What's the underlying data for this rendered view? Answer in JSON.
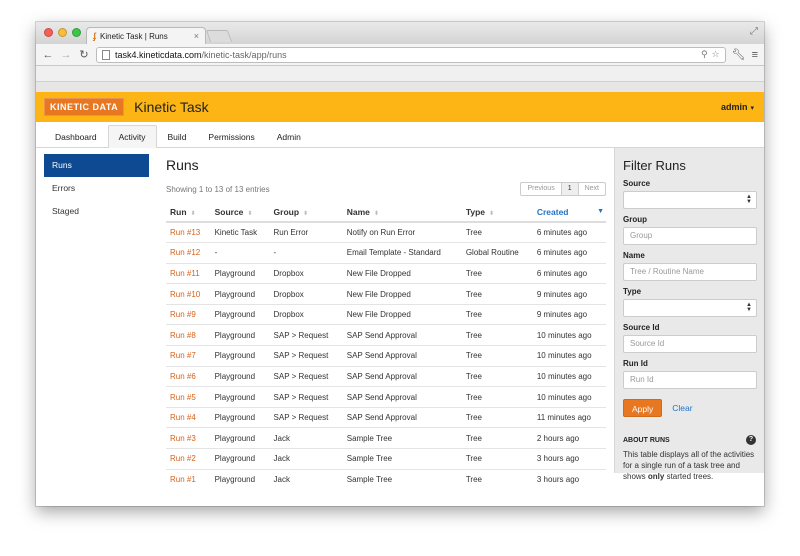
{
  "browser": {
    "tab_title": "Kinetic Task | Runs",
    "tab_close": "×",
    "url_host": "task4.kineticdata.com",
    "url_path": "/kinetic-task/app/runs"
  },
  "header": {
    "logo": "KINETIC DATA",
    "title": "Kinetic Task",
    "user": "admin"
  },
  "nav": {
    "tabs": [
      {
        "label": "Dashboard"
      },
      {
        "label": "Activity"
      },
      {
        "label": "Build"
      },
      {
        "label": "Permissions"
      },
      {
        "label": "Admin"
      }
    ]
  },
  "sidebar": {
    "items": [
      {
        "label": "Runs"
      },
      {
        "label": "Errors"
      },
      {
        "label": "Staged"
      }
    ]
  },
  "content": {
    "title": "Runs",
    "info": "Showing 1 to 13 of 13 entries",
    "pager": {
      "previous": "Previous",
      "current": "1",
      "next": "Next"
    },
    "columns": [
      "Run",
      "Source",
      "Group",
      "Name",
      "Type",
      "Created"
    ],
    "rows": [
      [
        "Run #13",
        "Kinetic Task",
        "Run Error",
        "Notify on Run Error",
        "Tree",
        "6 minutes ago"
      ],
      [
        "Run #12",
        "-",
        "-",
        "Email Template - Standard",
        "Global Routine",
        "6 minutes ago"
      ],
      [
        "Run #11",
        "Playground",
        "Dropbox",
        "New File Dropped",
        "Tree",
        "6 minutes ago"
      ],
      [
        "Run #10",
        "Playground",
        "Dropbox",
        "New File Dropped",
        "Tree",
        "9 minutes ago"
      ],
      [
        "Run #9",
        "Playground",
        "Dropbox",
        "New File Dropped",
        "Tree",
        "9 minutes ago"
      ],
      [
        "Run #8",
        "Playground",
        "SAP > Request",
        "SAP Send Approval",
        "Tree",
        "10 minutes ago"
      ],
      [
        "Run #7",
        "Playground",
        "SAP > Request",
        "SAP Send Approval",
        "Tree",
        "10 minutes ago"
      ],
      [
        "Run #6",
        "Playground",
        "SAP > Request",
        "SAP Send Approval",
        "Tree",
        "10 minutes ago"
      ],
      [
        "Run #5",
        "Playground",
        "SAP > Request",
        "SAP Send Approval",
        "Tree",
        "10 minutes ago"
      ],
      [
        "Run #4",
        "Playground",
        "SAP > Request",
        "SAP Send Approval",
        "Tree",
        "11 minutes ago"
      ],
      [
        "Run #3",
        "Playground",
        "Jack",
        "Sample Tree",
        "Tree",
        "2 hours ago"
      ],
      [
        "Run #2",
        "Playground",
        "Jack",
        "Sample Tree",
        "Tree",
        "3 hours ago"
      ],
      [
        "Run #1",
        "Playground",
        "Jack",
        "Sample Tree",
        "Tree",
        "3 hours ago"
      ]
    ]
  },
  "filter": {
    "title": "Filter Runs",
    "source_label": "Source",
    "group_label": "Group",
    "group_placeholder": "Group",
    "name_label": "Name",
    "name_placeholder": "Tree / Routine Name",
    "type_label": "Type",
    "source_id_label": "Source Id",
    "source_id_placeholder": "Source Id",
    "run_id_label": "Run Id",
    "run_id_placeholder": "Run Id",
    "apply": "Apply",
    "clear": "Clear",
    "about_title": "ABOUT RUNS",
    "about_text_1": "This table displays all of the activities for a single run of a task tree and shows ",
    "about_text_bold": "only",
    "about_text_2": " started trees."
  },
  "colors": {
    "header_bg": "#fdb515",
    "logo_bg": "#e87722",
    "sidebar_active": "#0d4a91",
    "run_link": "#d7621a",
    "link_blue": "#1f74c7"
  }
}
